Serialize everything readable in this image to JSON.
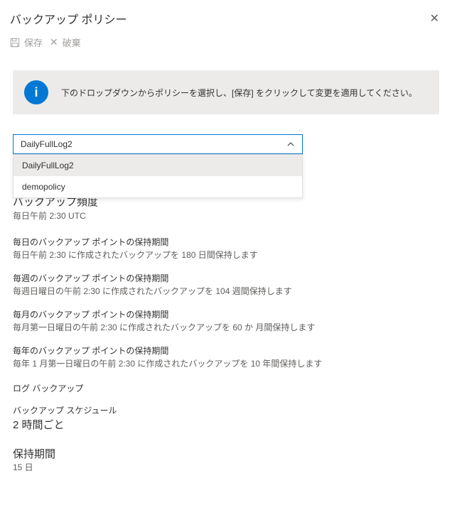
{
  "header": {
    "title": "バックアップ ポリシー"
  },
  "toolbar": {
    "save_label": "保存",
    "discard_label": "破棄"
  },
  "info_banner": {
    "text": "下のドロップダウンからポリシーを選択し、[保存] をクリックして変更を適用してください。"
  },
  "dropdown": {
    "selected": "DailyFullLog2",
    "options": [
      "DailyFullLog2",
      "demopolicy"
    ]
  },
  "sections": {
    "frequency": {
      "heading": "バックアップ頻度",
      "value": "毎日午前 2:30 UTC"
    },
    "daily_retention": {
      "heading": "毎日のバックアップ ポイントの保持期間",
      "value": "毎日午前 2:30 に作成されたバックアップを 180 日間保持します"
    },
    "weekly_retention": {
      "heading": "毎週のバックアップ ポイントの保持期間",
      "value": "毎週日曜日の午前 2:30 に作成されたバックアップを 104 週間保持します"
    },
    "monthly_retention": {
      "heading": "毎月のバックアップ ポイントの保持期間",
      "value": "毎月第一日曜日の午前 2:30 に作成されたバックアップを 60 か 月間保持します"
    },
    "yearly_retention": {
      "heading": "毎年のバックアップ ポイントの保持期間",
      "value": "毎年 1 月第一日曜日の午前 2:30 に作成されたバックアップを 10 年間保持します"
    },
    "log_backup_label": "ログ バックアップ",
    "schedule": {
      "heading": "バックアップ スケジュール",
      "value": "2 時間ごと"
    },
    "retention": {
      "heading": "保持期間",
      "value": "15 日"
    }
  }
}
